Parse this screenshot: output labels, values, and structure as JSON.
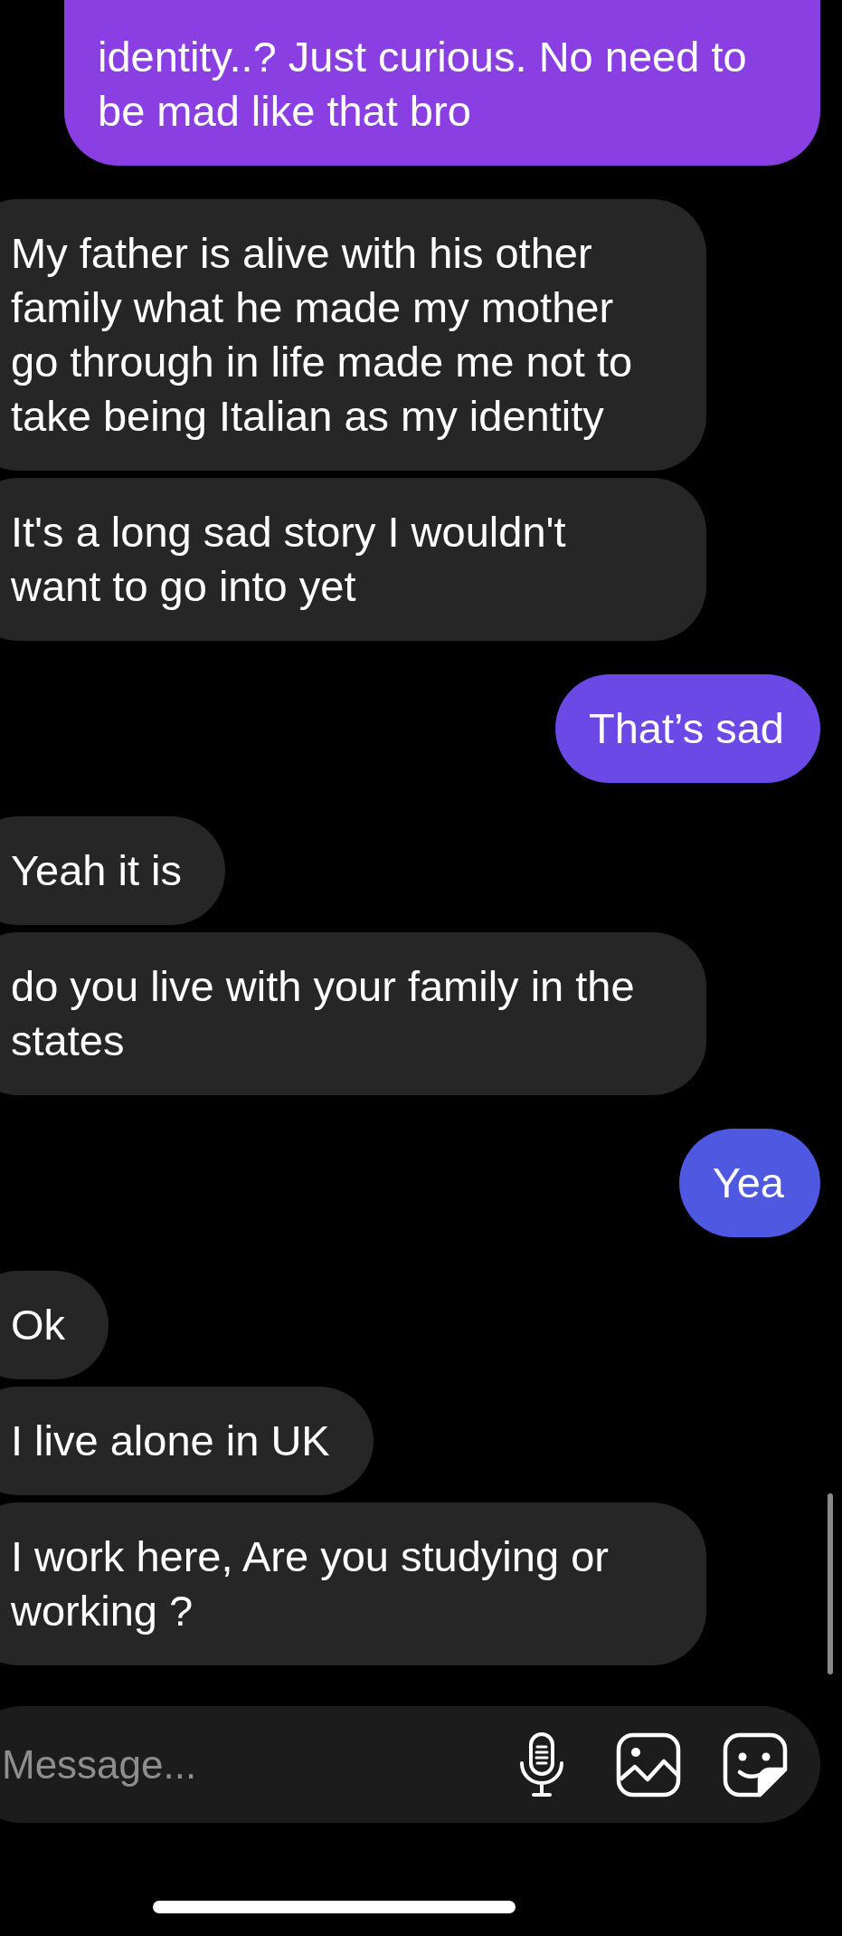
{
  "messages": [
    {
      "kind": "sent",
      "color": "#8a3fe2",
      "text": "identity..? Just curious. No need to be mad like that bro"
    },
    {
      "kind": "received",
      "text": "My father is alive with his other family what he made my mother go through in life made me not to take being Italian as my identity"
    },
    {
      "kind": "received",
      "text": "It's a long sad story I wouldn't want to go into yet"
    },
    {
      "kind": "sent",
      "color": "#6a49e6",
      "text": "That’s sad"
    },
    {
      "kind": "received",
      "text": "Yeah it is"
    },
    {
      "kind": "received",
      "text": "do you live with your family in the states"
    },
    {
      "kind": "sent",
      "color": "#4f58e0",
      "text": "Yea"
    },
    {
      "kind": "received",
      "text": "Ok"
    },
    {
      "kind": "received",
      "text": "I live alone in UK"
    },
    {
      "kind": "received",
      "text": "I work here, Are you studying or working ?"
    }
  ],
  "composer": {
    "placeholder": "Message..."
  }
}
